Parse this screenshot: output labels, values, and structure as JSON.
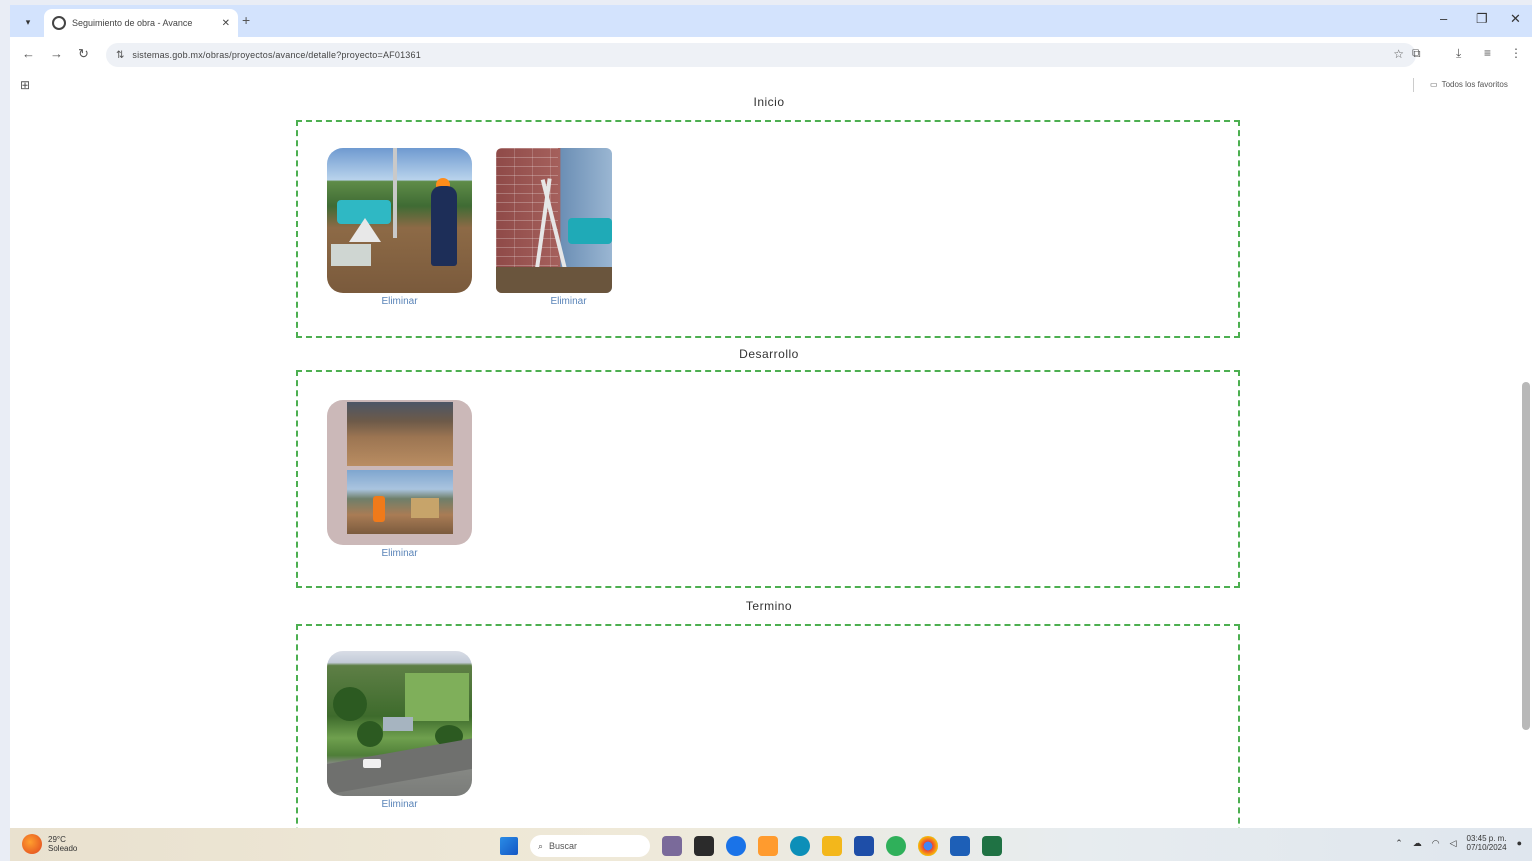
{
  "browser": {
    "tab_title": "Seguimiento de obra - Avance",
    "url": "sistemas.gob.mx/obras/proyectos/avance/detalle?proyecto=AF01361",
    "all_bookmarks_label": "Todos los favoritos"
  },
  "page": {
    "sections": [
      {
        "title": "Inicio",
        "photos": [
          {
            "name": "foto-inicio-1",
            "delete_label": "Eliminar"
          },
          {
            "name": "foto-inicio-2",
            "delete_label": "Eliminar"
          }
        ]
      },
      {
        "title": "Desarrollo",
        "photos": [
          {
            "name": "foto-desarrollo-1",
            "delete_label": "Eliminar"
          }
        ]
      },
      {
        "title": "Termino",
        "photos": [
          {
            "name": "foto-termino-1",
            "delete_label": "Eliminar"
          }
        ]
      }
    ]
  },
  "taskbar": {
    "weather_temp": "29°C",
    "weather_desc": "Soleado",
    "search_placeholder": "Buscar",
    "clock_time": "03:45 p. m.",
    "clock_date": "07/10/2024"
  },
  "colors": {
    "section_border": "#4caf50",
    "delete_link": "#5a84b8",
    "tab_strip": "#d3e3fd"
  }
}
